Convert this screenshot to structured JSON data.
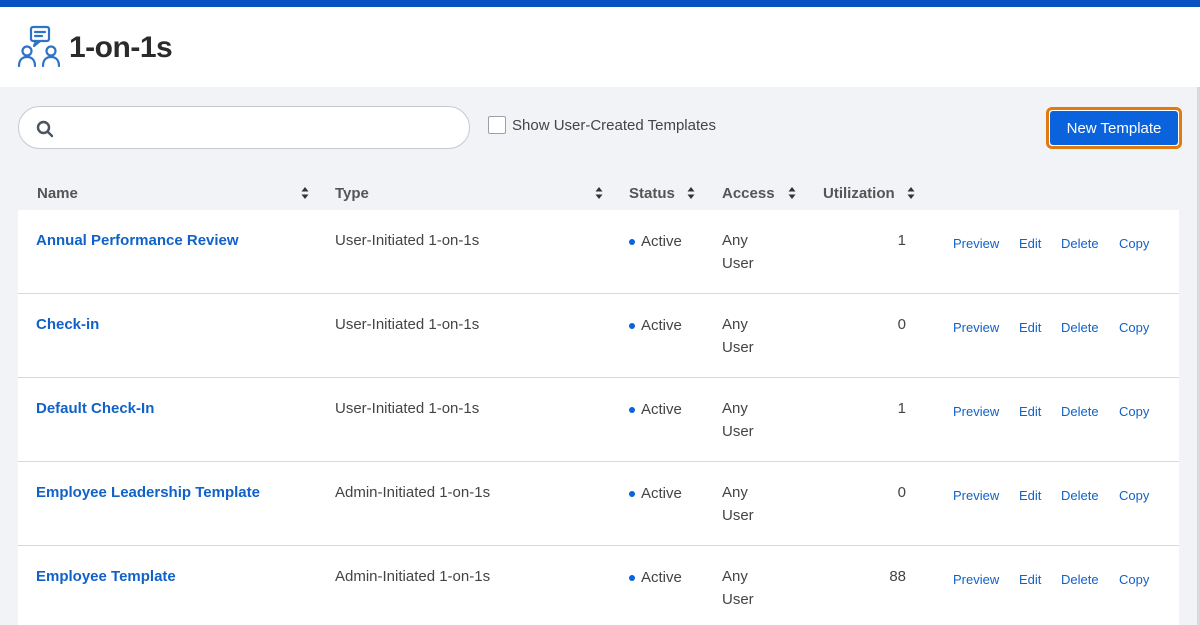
{
  "header": {
    "title": "1-on-1s",
    "icon": "one-on-one-people-icon"
  },
  "toolbar": {
    "search_placeholder": "",
    "show_user_created_label": "Show User-Created Templates",
    "show_user_created_checked": false,
    "new_template_label": "New Template"
  },
  "table": {
    "columns": [
      "Name",
      "Type",
      "Status",
      "Access",
      "Utilization"
    ],
    "action_labels": {
      "preview": "Preview",
      "edit": "Edit",
      "delete": "Delete",
      "copy": "Copy"
    },
    "rows": [
      {
        "name": "Annual Performance Review",
        "type": "User-Initiated 1-on-1s",
        "status": "Active",
        "access_line1": "Any",
        "access_line2": "User",
        "utilization": "1"
      },
      {
        "name": "Check-in",
        "type": "User-Initiated 1-on-1s",
        "status": "Active",
        "access_line1": "Any",
        "access_line2": "User",
        "utilization": "0"
      },
      {
        "name": "Default Check-In",
        "type": "User-Initiated 1-on-1s",
        "status": "Active",
        "access_line1": "Any",
        "access_line2": "User",
        "utilization": "1"
      },
      {
        "name": "Employee Leadership Template",
        "type": "Admin-Initiated 1-on-1s",
        "status": "Active",
        "access_line1": "Any",
        "access_line2": "User",
        "utilization": "0"
      },
      {
        "name": "Employee Template",
        "type": "Admin-Initiated 1-on-1s",
        "status": "Active",
        "access_line1": "Any",
        "access_line2": "User",
        "utilization": "88"
      }
    ]
  },
  "colors": {
    "brand_blue": "#0a52c4",
    "link_blue": "#1062c9",
    "button_blue": "#0a62dc",
    "focus_orange": "#e07b10"
  }
}
